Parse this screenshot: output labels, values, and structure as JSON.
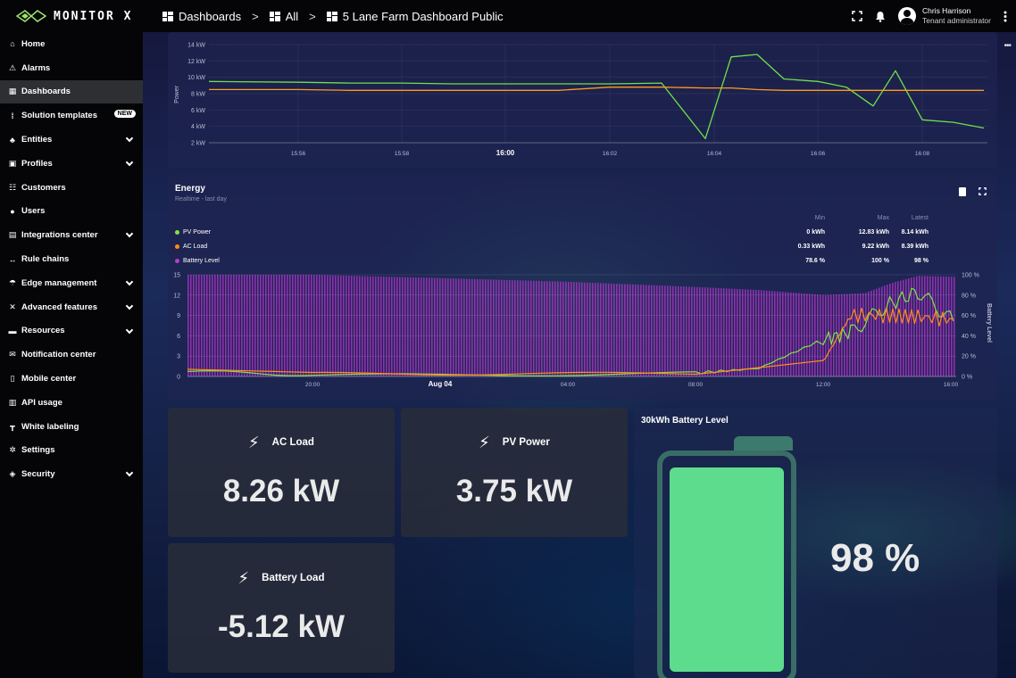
{
  "app": {
    "name": "MONITOR X",
    "breadcrumb": [
      "Dashboards",
      "All",
      "5 Lane Farm Dashboard Public"
    ],
    "user": {
      "name": "Chris Harrison",
      "role": "Tenant administrator"
    }
  },
  "sidebar": {
    "items": [
      {
        "label": "Home",
        "icon": "home-icon",
        "glyph": "⌂",
        "expand": false
      },
      {
        "label": "Alarms",
        "icon": "alarm-icon",
        "glyph": "⚠",
        "expand": false
      },
      {
        "label": "Dashboards",
        "icon": "dashboard-icon",
        "glyph": "▦",
        "expand": false,
        "active": true
      },
      {
        "label": "Solution templates",
        "icon": "template-icon",
        "glyph": "⁞",
        "expand": false,
        "badge": "NEW"
      },
      {
        "label": "Entities",
        "icon": "entities-icon",
        "glyph": "♣",
        "expand": true
      },
      {
        "label": "Profiles",
        "icon": "profiles-icon",
        "glyph": "▣",
        "expand": true
      },
      {
        "label": "Customers",
        "icon": "customers-icon",
        "glyph": "☷",
        "expand": false
      },
      {
        "label": "Users",
        "icon": "users-icon",
        "glyph": "●",
        "expand": false
      },
      {
        "label": "Integrations center",
        "icon": "integrations-icon",
        "glyph": "▤",
        "expand": true
      },
      {
        "label": "Rule chains",
        "icon": "rule-chains-icon",
        "glyph": "↔",
        "expand": false
      },
      {
        "label": "Edge management",
        "icon": "edge-icon",
        "glyph": "☂",
        "expand": true
      },
      {
        "label": "Advanced features",
        "icon": "advanced-icon",
        "glyph": "✕",
        "expand": true
      },
      {
        "label": "Resources",
        "icon": "folder-icon",
        "glyph": "▬",
        "expand": true
      },
      {
        "label": "Notification center",
        "icon": "notification-icon",
        "glyph": "✉",
        "expand": false
      },
      {
        "label": "Mobile center",
        "icon": "mobile-icon",
        "glyph": "▯",
        "expand": false
      },
      {
        "label": "API usage",
        "icon": "api-icon",
        "glyph": "▥",
        "expand": false
      },
      {
        "label": "White labeling",
        "icon": "white-label-icon",
        "glyph": "┳",
        "expand": false
      },
      {
        "label": "Settings",
        "icon": "settings-icon",
        "glyph": "✲",
        "expand": false
      },
      {
        "label": "Security",
        "icon": "security-icon",
        "glyph": "◈",
        "expand": true
      }
    ]
  },
  "power_chart": {
    "ylabel": "Power",
    "y_ticks": [
      "14 kW",
      "12 kW",
      "10 kW",
      "8 kW",
      "6 kW",
      "4 kW",
      "2 kW"
    ],
    "x_ticks": [
      "15:56",
      "15:58",
      "16:00",
      "16:02",
      "16:04",
      "16:06",
      "16:08"
    ],
    "colors": {
      "pv": "#6fe04a",
      "ac": "#ff9a1f"
    }
  },
  "energy": {
    "title": "Energy",
    "subtitle": "Realtime - last day",
    "legend_header": [
      "Min",
      "Max",
      "Latest"
    ],
    "legend": [
      {
        "name": "PV Power",
        "color": "#7de349",
        "min": "0 kWh",
        "max": "12.83 kWh",
        "latest": "8.14 kWh"
      },
      {
        "name": "AC Load",
        "color": "#ff8c1a",
        "min": "0.33 kWh",
        "max": "9.22 kWh",
        "latest": "8.39 kWh"
      },
      {
        "name": "Battery Level",
        "color": "#b440c8",
        "min": "78.6 %",
        "max": "100 %",
        "latest": "98 %"
      }
    ],
    "y_left_ticks": [
      "15",
      "12",
      "9",
      "6",
      "3",
      "0"
    ],
    "y_right_ticks": [
      "100 %",
      "80 %",
      "60 %",
      "40 %",
      "20 %",
      "0 %"
    ],
    "y_right_label": "Battery Level",
    "x_ticks": [
      "20:00",
      "Aug 04",
      "04:00",
      "08:00",
      "12:00",
      "16:00"
    ]
  },
  "cards": {
    "ac_load": {
      "label": "AC Load",
      "value": "8.26 kW"
    },
    "pv_power": {
      "label": "PV Power",
      "value": "3.75 kW"
    },
    "battery_load": {
      "label": "Battery Load",
      "value": "-5.12 kW"
    },
    "battery_level": {
      "title": "30kWh Battery Level",
      "value": "98 %",
      "level": 0.98,
      "color": "#5edc8e"
    }
  },
  "chart_data": [
    {
      "type": "line",
      "ylabel": "Power",
      "ylim": [
        1,
        15
      ],
      "x": [
        "15:55",
        "15:56",
        "15:57",
        "15:58",
        "15:59",
        "16:00",
        "16:01",
        "16:02",
        "16:03",
        "16:04",
        "16:04.5",
        "16:05",
        "16:05.5",
        "16:06",
        "16:06.5",
        "16:07",
        "16:07.5",
        "16:08",
        "16:08.5",
        "16:09"
      ],
      "series": [
        {
          "name": "PV Power",
          "values": [
            9.5,
            9.4,
            9.3,
            9.3,
            9.2,
            9.2,
            9.2,
            9.2,
            9.3,
            2.5,
            12.5,
            12.8,
            9.8,
            9.5,
            8.8,
            6.5,
            10.8,
            4.8,
            4.5,
            3.8
          ]
        },
        {
          "name": "AC Load",
          "values": [
            8.5,
            8.5,
            8.4,
            8.4,
            8.4,
            8.4,
            8.4,
            8.8,
            8.8,
            8.7,
            8.7,
            8.5,
            8.4,
            8.4,
            8.4,
            8.4,
            8.4,
            8.4,
            8.4,
            8.4
          ]
        }
      ]
    },
    {
      "type": "line",
      "title": "Energy",
      "x": [
        "17:00",
        "20:00",
        "Aug 04",
        "04:00",
        "08:00",
        "10:00",
        "12:00",
        "13:00",
        "14:00",
        "15:00",
        "16:00"
      ],
      "series": [
        {
          "name": "PV Power",
          "values": [
            0.8,
            0.2,
            0.2,
            0.3,
            0.5,
            1.2,
            5.5,
            6.5,
            10.5,
            12.5,
            8.14
          ]
        },
        {
          "name": "AC Load",
          "values": [
            0.9,
            0.4,
            0.4,
            0.4,
            0.5,
            1.5,
            2.2,
            9.0,
            9.0,
            8.8,
            8.39
          ]
        },
        {
          "name": "Battery Level",
          "values": [
            100,
            100,
            97,
            93,
            88,
            85,
            80,
            82,
            92,
            99,
            98
          ]
        }
      ]
    }
  ]
}
